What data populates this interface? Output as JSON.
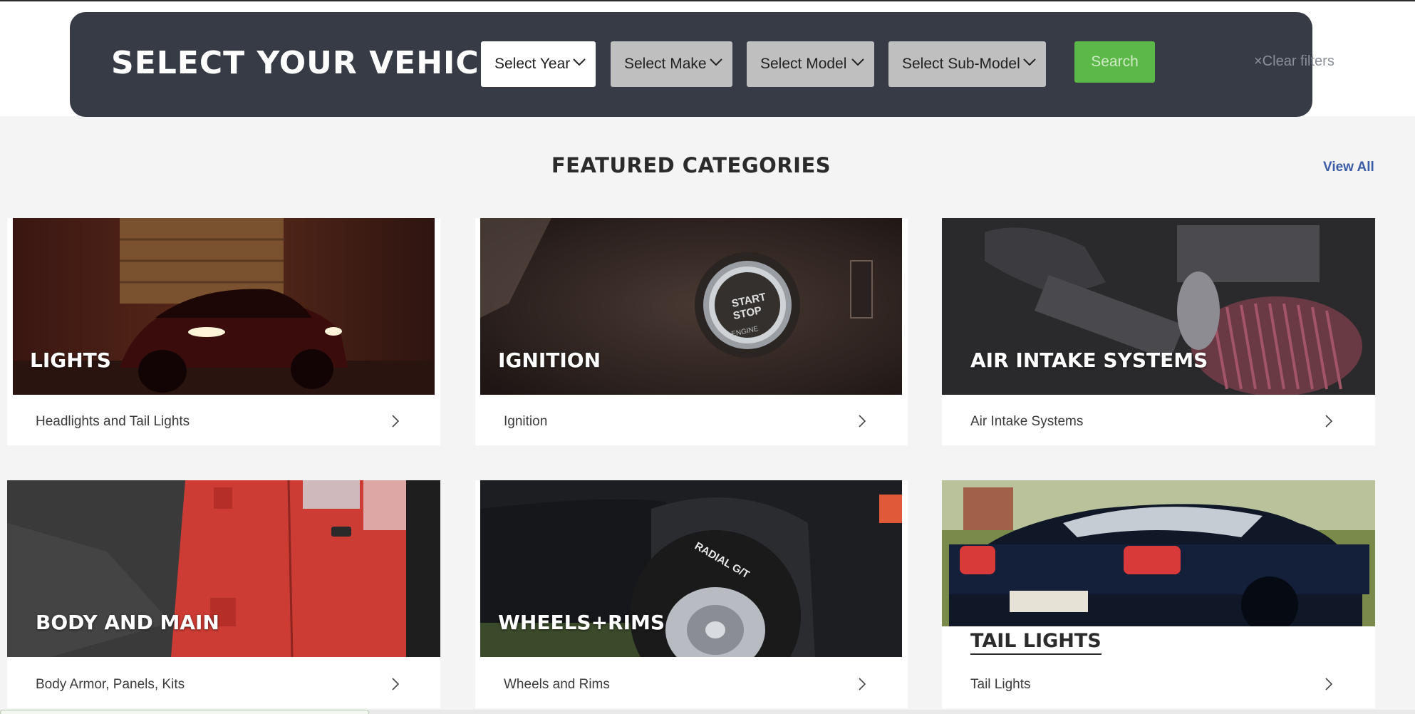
{
  "vehicle_selector": {
    "title": "SELECT YOUR VEHICLE",
    "year_select": "Select Year",
    "make_select": "Select Make",
    "model_select": "Select Model",
    "submodel_select": "Select Sub-Model",
    "search_label": "Search",
    "clear_label": "×Clear filters"
  },
  "featured": {
    "title": "FEATURED CATEGORIES",
    "view_all": "View All"
  },
  "categories": [
    {
      "title": "LIGHTS",
      "description": "Headlights and Tail Lights"
    },
    {
      "title": "IGNITION",
      "description": "Ignition"
    },
    {
      "title": "AIR INTAKE SYSTEMS",
      "description": "Air Intake Systems"
    },
    {
      "title": "BODY AND MAIN",
      "description": "Body Armor, Panels, Kits"
    },
    {
      "title": "WHEELS+RIMS",
      "description": "Wheels and Rims"
    },
    {
      "title": "TAIL LIGHTS",
      "description": "Tail Lights"
    }
  ],
  "image_text": {
    "start_stop": "START",
    "start_stop_2": "STOP",
    "engine": "ENGINE",
    "radial": "RADIAL G/T"
  },
  "colors": {
    "vehicle_bar_bg": "#363b46",
    "search_green": "#5cb848",
    "view_all_blue": "#3d5ca8",
    "page_bg": "#f4f4f4"
  }
}
